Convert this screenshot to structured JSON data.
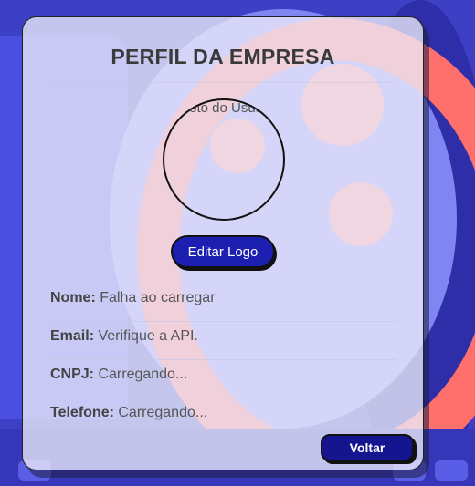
{
  "page": {
    "title": "PERFIL DA EMPRESA",
    "logo_alt": "Foto do Usuário"
  },
  "actions": {
    "edit_logo_label": "Editar Logo",
    "back_label": "Voltar"
  },
  "fields": [
    {
      "label": "Nome:",
      "value": "Falha ao carregar"
    },
    {
      "label": "Email:",
      "value": "Verifique a API."
    },
    {
      "label": "CNPJ:",
      "value": "Carregando..."
    },
    {
      "label": "Telefone:",
      "value": "Carregando..."
    }
  ],
  "colors": {
    "primary_button": "#1c1fb0",
    "back_button": "#15158f",
    "background": "#3d3fc4",
    "accent_ring": "#ff6f6b"
  }
}
